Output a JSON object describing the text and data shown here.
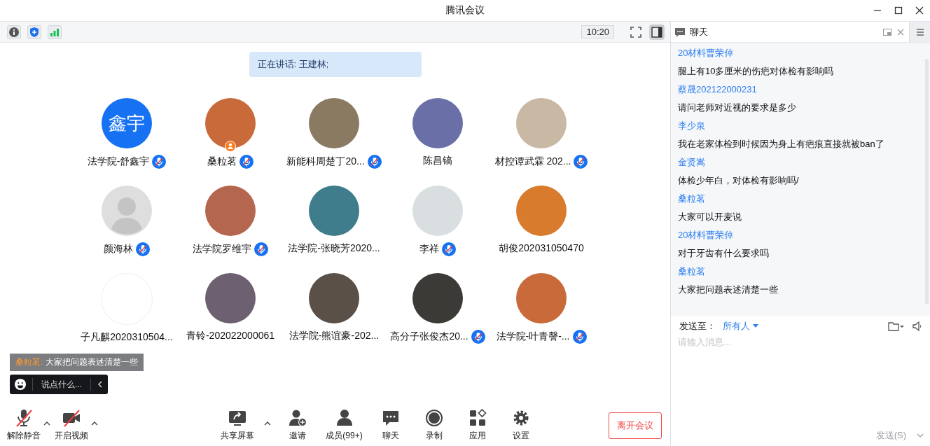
{
  "window": {
    "title": "腾讯会议"
  },
  "top_bar": {
    "time": "10:20"
  },
  "speaking_banner": "正在讲话: 王建林;",
  "participants": [
    {
      "name": "法学院-舒鑫宇",
      "kind": "initials",
      "initials": "鑫宇",
      "muted": true,
      "host": false
    },
    {
      "name": "桑粒茗",
      "kind": "photo",
      "muted": true,
      "host": true
    },
    {
      "name": "新能科周楚丁20...",
      "kind": "photo",
      "muted": true,
      "host": false
    },
    {
      "name": "陈昌镐",
      "kind": "photo",
      "muted": false,
      "host": false
    },
    {
      "name": "材控谭武霖 202...",
      "kind": "photo",
      "muted": true,
      "host": false
    },
    {
      "name": "颜海林",
      "kind": "silhouette",
      "muted": true,
      "host": false
    },
    {
      "name": "法学院罗维宇",
      "kind": "photo",
      "muted": true,
      "host": false
    },
    {
      "name": "法学院-张晓芳2020...",
      "kind": "photo",
      "muted": false,
      "host": false
    },
    {
      "name": "李祥",
      "kind": "photo",
      "muted": true,
      "host": false
    },
    {
      "name": "胡俊202031050470",
      "kind": "photo",
      "muted": false,
      "host": false
    },
    {
      "name": "子凡麒2020310504...",
      "kind": "photo",
      "muted": false,
      "host": false
    },
    {
      "name": "青铃-202022000061",
      "kind": "photo",
      "muted": false,
      "host": false
    },
    {
      "name": "法学院-熊谊豪-202...",
      "kind": "photo",
      "muted": false,
      "host": false
    },
    {
      "name": "高分子张俊杰20...",
      "kind": "photo",
      "muted": true,
      "host": false
    },
    {
      "name": "法学院-叶青謦-...",
      "kind": "photo",
      "muted": true,
      "host": false
    }
  ],
  "toast": {
    "sender": "桑粒茗:",
    "message": "大家把问题表述清楚一些"
  },
  "quick_input": {
    "placeholder": "说点什么..."
  },
  "toolbar": [
    {
      "kind": "mic",
      "label": "解除静音",
      "off": true,
      "caret": true
    },
    {
      "kind": "video",
      "label": "开启视频",
      "off": true,
      "caret": true
    },
    {
      "kind": "share",
      "label": "共享屏幕",
      "off": false,
      "caret": true
    },
    {
      "kind": "invite",
      "label": "邀请",
      "off": false,
      "caret": false
    },
    {
      "kind": "members",
      "label": "成员(99+)",
      "off": false,
      "caret": false
    },
    {
      "kind": "chat",
      "label": "聊天",
      "off": false,
      "caret": false
    },
    {
      "kind": "record",
      "label": "录制",
      "off": false,
      "caret": false
    },
    {
      "kind": "apps",
      "label": "应用",
      "off": false,
      "caret": false
    },
    {
      "kind": "settings",
      "label": "设置",
      "off": false,
      "caret": false
    }
  ],
  "leave_button": "离开会议",
  "chat": {
    "title": "聊天",
    "messages": [
      {
        "sender": "20材料曹荣倬",
        "text": "腿上有10多厘米的伤疤对体检有影响吗"
      },
      {
        "sender": "蔡晟202122000231",
        "text": "请问老师对近视的要求是多少"
      },
      {
        "sender": "李少泉",
        "text": "我在老家体检到时候因为身上有疤痕直接就被ban了"
      },
      {
        "sender": "金贤嵩",
        "text": "体检少年白，对体检有影响吗/"
      },
      {
        "sender": "桑粒茗",
        "text": "大家可以开麦说"
      },
      {
        "sender": "20材料曹荣倬",
        "text": "对于牙齿有什么要求吗"
      },
      {
        "sender": "桑粒茗",
        "text": "大家把问题表述清楚一些"
      }
    ],
    "send_to_label": "发送至：",
    "recipient": "所有人",
    "placeholder": "请输入消息...",
    "send_button": {
      "label": "发送(S)",
      "disabled": true
    }
  }
}
